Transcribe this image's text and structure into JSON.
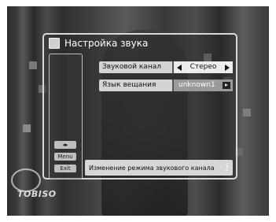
{
  "window": {
    "title": "Настройка звука"
  },
  "settings": {
    "audio_channel": {
      "label": "Звуковой канал",
      "value": "Стерео"
    },
    "broadcast_language": {
      "label": "Язык вещания",
      "value": "unknown1"
    }
  },
  "keys": {
    "arrows": "◂▸",
    "menu": "Menu",
    "exit": "Exit"
  },
  "status": {
    "text": "Изменение режима звукового канала",
    "info_glyph": "i"
  },
  "watermark": {
    "text": "TOBISO"
  }
}
